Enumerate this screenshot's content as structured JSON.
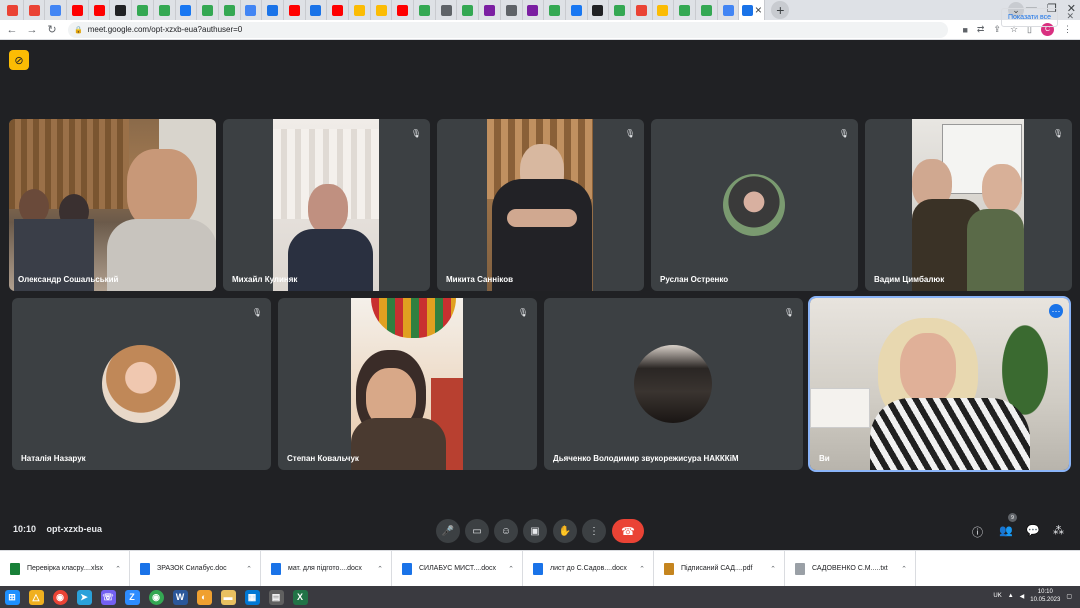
{
  "browser": {
    "url": "meet.google.com/opt-xzxb-eua?authuser=0",
    "profile_initial": "С",
    "tab_close": "×",
    "favicons": [
      "#ea4335",
      "#ea4335",
      "#4285f4",
      "#ff0000",
      "#ff0000",
      "#202124",
      "#34a853",
      "#34a853",
      "#1877f2",
      "#34a853",
      "#34a853",
      "#4285f4",
      "#1a73e8",
      "#ff0000",
      "#1a73e8",
      "#ff0000",
      "#fbbc04",
      "#fbbc04",
      "#ff0000",
      "#34a853",
      "#5f6368",
      "#34a853",
      "#7b1fa2",
      "#5f6368",
      "#7b1fa2",
      "#34a853",
      "#1877f2",
      "#202124",
      "#34a853",
      "#ea4335",
      "#fbbc04",
      "#34a853",
      "#34a853",
      "#4285f4",
      "#1a73e8"
    ]
  },
  "meeting": {
    "time": "10:10",
    "code": "opt-xzxb-eua",
    "participant_count": "9"
  },
  "tiles": [
    {
      "name": "Олександр Сошальський",
      "muted": false
    },
    {
      "name": "Михайл Кулиняк",
      "muted": true
    },
    {
      "name": "Микита Санніков",
      "muted": true
    },
    {
      "name": "Руслан Остренко",
      "muted": true
    },
    {
      "name": "Вадим Цимбалюк",
      "muted": true
    },
    {
      "name": "Наталія Назарук",
      "muted": true
    },
    {
      "name": "Степан Ковальчук",
      "muted": true
    },
    {
      "name": "Дьяченко Володимир звукорежисура НАКККіМ",
      "muted": true
    },
    {
      "name": "Ви",
      "muted": false
    }
  ],
  "downloads": [
    {
      "name": "Перевірка класру....xlsx",
      "color": "#188038"
    },
    {
      "name": "ЗРАЗОК Силабус.doc",
      "color": "#1a73e8"
    },
    {
      "name": "мат. для підгото....docx",
      "color": "#1a73e8"
    },
    {
      "name": "СИЛАБУС МИСТ....docx",
      "color": "#1a73e8"
    },
    {
      "name": "лист до С.Садов....docx",
      "color": "#1a73e8"
    },
    {
      "name": "Підписаний САД....pdf",
      "color": "#c5851f"
    },
    {
      "name": "САДОВЕНКО С.М.....txt",
      "color": "#9aa0a6"
    }
  ],
  "show_all": "Показати все",
  "taskbar": {
    "language": "UK",
    "time": "10:10",
    "date": "10.05.2023"
  }
}
